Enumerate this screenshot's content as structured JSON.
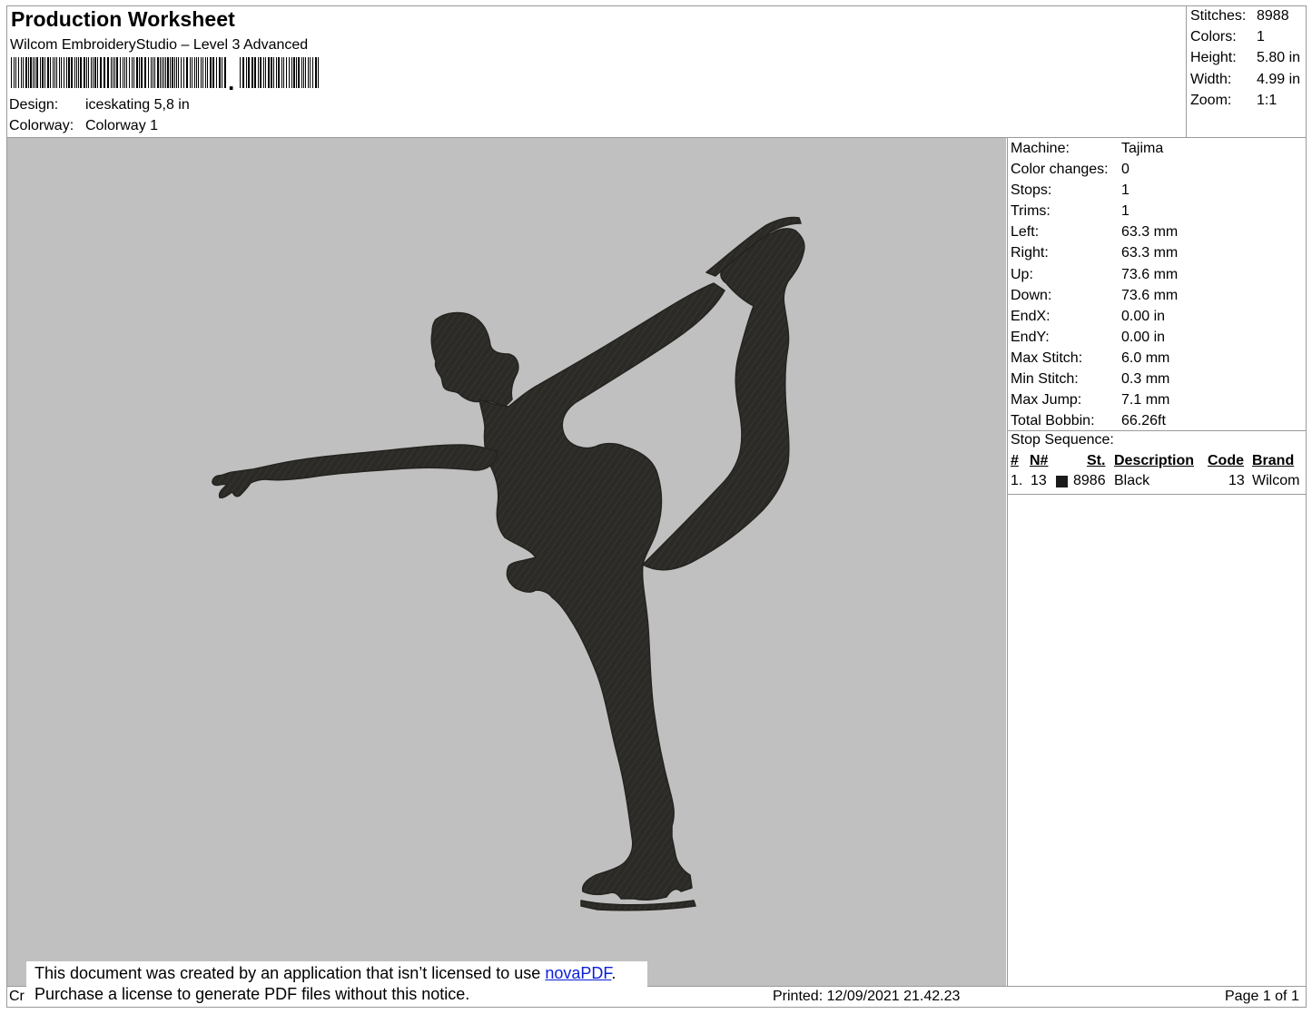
{
  "header": {
    "title": "Production Worksheet",
    "software": "Wilcom EmbroideryStudio – Level 3 Advanced",
    "barcode_separator": ",",
    "design_label": "Design:",
    "design_value": "iceskating 5,8 in",
    "colorway_label": "Colorway:",
    "colorway_value": "Colorway 1"
  },
  "summary": [
    {
      "label": "Stitches:",
      "value": "8988"
    },
    {
      "label": "Colors:",
      "value": "1"
    },
    {
      "label": "Height:",
      "value": "5.80 in"
    },
    {
      "label": "Width:",
      "value": "4.99 in"
    },
    {
      "label": "Zoom:",
      "value": "1:1"
    }
  ],
  "machine_info": [
    {
      "label": "Machine:",
      "value": "Tajima"
    },
    {
      "label": "Color changes:",
      "value": "0"
    },
    {
      "label": "Stops:",
      "value": "1"
    },
    {
      "label": "Trims:",
      "value": "1"
    },
    {
      "label": "Left:",
      "value": "63.3 mm"
    },
    {
      "label": "Right:",
      "value": "63.3 mm"
    },
    {
      "label": "Up:",
      "value": "73.6 mm"
    },
    {
      "label": "Down:",
      "value": "73.6 mm"
    },
    {
      "label": "EndX:",
      "value": "0.00 in"
    },
    {
      "label": "EndY:",
      "value": "0.00 in"
    },
    {
      "label": "Max Stitch:",
      "value": "6.0 mm"
    },
    {
      "label": "Min Stitch:",
      "value": "0.3 mm"
    },
    {
      "label": "Max Jump:",
      "value": "7.1 mm"
    },
    {
      "label": "Total Bobbin:",
      "value": "66.26ft"
    }
  ],
  "stop_sequence": {
    "title": "Stop Sequence:",
    "columns": {
      "num": "#",
      "needle": "N#",
      "stitches": "St.",
      "description": "Description",
      "code": "Code",
      "brand": "Brand"
    },
    "rows": [
      {
        "num": "1.",
        "needle": "13",
        "color": "#1a1a1a",
        "stitches": "8986",
        "description": "Black",
        "code": "13",
        "brand": "Wilcom"
      }
    ]
  },
  "design_preview": {
    "background_color": "#c0c0c0",
    "thread_color": "#2b2a26",
    "icon": "ice-skater-silhouette"
  },
  "footer": {
    "left_clip": "Cr",
    "printed": "Printed: 12/09/2021 21.42.23",
    "page": "Page 1 of 1"
  },
  "notice": {
    "line1_prefix": "This document was created by an application that isn’t licensed to use ",
    "link": "novaPDF",
    "line1_suffix": ".",
    "line2": "Purchase a license to generate PDF files without this notice."
  }
}
